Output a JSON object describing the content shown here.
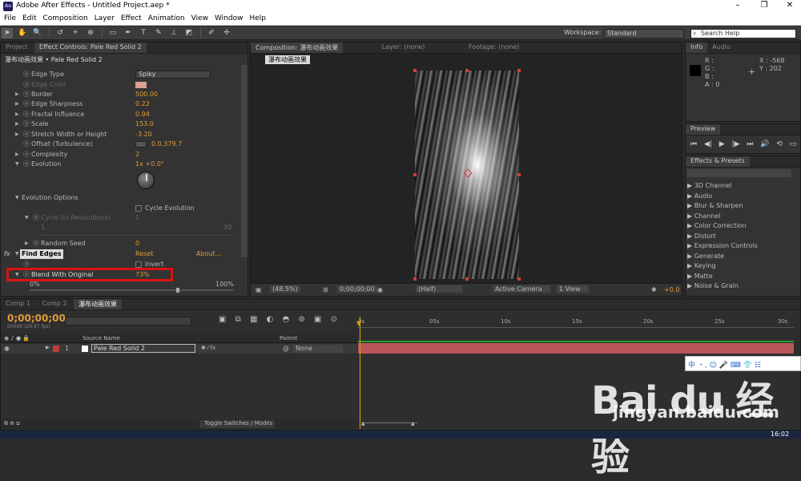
{
  "window": {
    "title": "Adobe After Effects - Untitled Project.aep *",
    "app_icon": "Ae"
  },
  "menu": [
    "File",
    "Edit",
    "Composition",
    "Layer",
    "Effect",
    "Animation",
    "View",
    "Window",
    "Help"
  ],
  "toolbar": {
    "workspace_label": "Workspace:",
    "workspace_value": "Standard",
    "search_placeholder": "Search Help"
  },
  "left_panel": {
    "tabs": [
      "Project",
      "Effect Controls: Pale Red Solid 2"
    ],
    "breadcrumb": "瀑布动画效果 • Pale Red Solid 2",
    "rows": [
      {
        "label": "Edge Type",
        "value": "Spiky"
      },
      {
        "label": "Edge Color",
        "value": ""
      },
      {
        "label": "Border",
        "value": "500.00"
      },
      {
        "label": "Edge Sharpness",
        "value": "0.22"
      },
      {
        "label": "Fractal Influence",
        "value": "0.94"
      },
      {
        "label": "Scale",
        "value": "153.0"
      },
      {
        "label": "Stretch Width or Height",
        "value": "-3.20"
      },
      {
        "label": "Offset (Turbulence)",
        "value": "0.0,379.7"
      },
      {
        "label": "Complexity",
        "value": "2"
      },
      {
        "label": "Evolution",
        "value": "1x +0.0°"
      }
    ],
    "evolution_options": "Evolution Options",
    "cycle_evolution": "Cycle Evolution",
    "cycle_revolutions": {
      "label": "Cycle (in Revolutions)",
      "value": "1",
      "min": "1",
      "max": "30"
    },
    "random_seed": {
      "label": "Random Seed",
      "value": "0"
    },
    "find_edges": {
      "label": "Find Edges",
      "reset": "Reset",
      "about": "About...",
      "invert": "Invert"
    },
    "blend": {
      "label": "Blend With Original",
      "value": "73%",
      "min": "0%",
      "max": "100%",
      "level": 0.73
    }
  },
  "comp_panel": {
    "tabs": [
      "Composition: 瀑布动画效果",
      "Layer: (none)",
      "Footage: (none)"
    ],
    "comp_name": "瀑布动画效果",
    "zoom": "(48.5%)",
    "timecode": "0;00;00;00",
    "resolution": "(Half)",
    "camera": "Active Camera",
    "view": "1 View",
    "exposure": "+0.0"
  },
  "info_panel": {
    "tabs": [
      "Info",
      "Audio"
    ],
    "r": "R :",
    "g": "G :",
    "b": "B :",
    "a": "A : 0",
    "x": "X : -568",
    "y": "Y : 202"
  },
  "preview_panel": {
    "tab": "Preview"
  },
  "effects_panel": {
    "tab": "Effects & Presets",
    "items": [
      "3D Channel",
      "Audio",
      "Blur & Sharpen",
      "Channel",
      "Color Correction",
      "Distort",
      "Expression Controls",
      "Generate",
      "Keying",
      "Matte",
      "Noise & Grain"
    ]
  },
  "timeline": {
    "tabs": [
      "Comp 1",
      "Comp 2",
      "瀑布动画效果"
    ],
    "timecode": "0;00;00;00",
    "frame_info": "00000 (29.97 fps)",
    "columns": {
      "source": "Source Name",
      "parent": "Parent"
    },
    "layer": {
      "num": "1",
      "name": "Pale Red Solid 2",
      "parent": "None"
    },
    "ruler": [
      "0s",
      "05s",
      "10s",
      "15s",
      "20s",
      "25s",
      "30s"
    ],
    "toggle": "Toggle Switches / Modes"
  },
  "overlay": {
    "ime": "中 ・, ☺ 🎤 ⌨ 👕 ☷",
    "watermark": "Bai du 经验",
    "watermark_url": "jingyan.baidu.com",
    "clock": "16:02"
  },
  "colors": {
    "accent": "#e29b38",
    "highlight": "#dd1111",
    "layer_bar": "#b9575a"
  }
}
